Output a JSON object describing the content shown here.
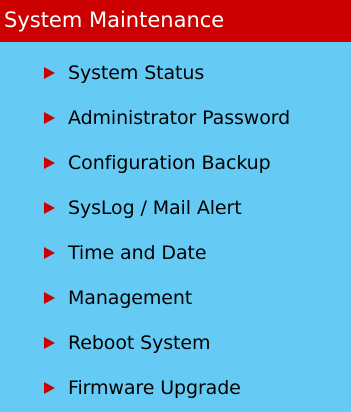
{
  "header": {
    "title": "System Maintenance"
  },
  "menu": {
    "items": [
      {
        "label": "System Status",
        "icon": "arrow-right-icon"
      },
      {
        "label": "Administrator Password",
        "icon": "arrow-right-icon"
      },
      {
        "label": "Configuration Backup",
        "icon": "arrow-right-icon"
      },
      {
        "label": "SysLog / Mail Alert",
        "icon": "arrow-right-icon"
      },
      {
        "label": "Time and Date",
        "icon": "arrow-right-icon"
      },
      {
        "label": "Management",
        "icon": "arrow-right-icon"
      },
      {
        "label": "Reboot System",
        "icon": "arrow-right-icon"
      },
      {
        "label": "Firmware Upgrade",
        "icon": "arrow-right-icon"
      }
    ]
  },
  "colors": {
    "header_bg": "#cc0000",
    "panel_bg": "#66cbf4",
    "arrow": "#cc0000"
  }
}
